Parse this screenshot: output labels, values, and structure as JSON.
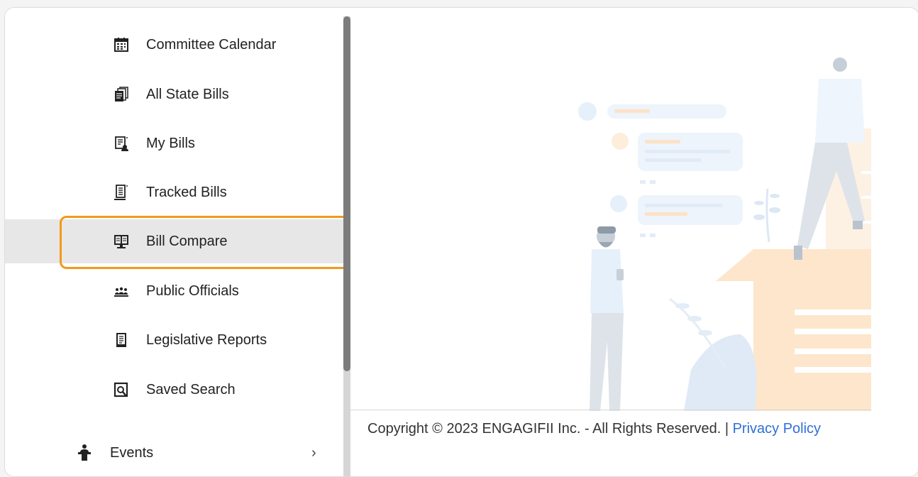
{
  "sidebar": {
    "items": [
      {
        "label": "Committee Calendar",
        "icon": "calendar-icon"
      },
      {
        "label": "All State Bills",
        "icon": "documents-stack-icon"
      },
      {
        "label": "My Bills",
        "icon": "user-document-icon"
      },
      {
        "label": "Tracked Bills",
        "icon": "tracked-document-icon"
      },
      {
        "label": "Bill Compare",
        "icon": "compare-monitor-icon",
        "selected": true
      },
      {
        "label": "Public Officials",
        "icon": "people-group-icon"
      },
      {
        "label": "Legislative Reports",
        "icon": "report-icon"
      },
      {
        "label": "Saved Search",
        "icon": "saved-search-icon"
      }
    ],
    "events": {
      "label": "Events",
      "icon": "speaker-podium-icon",
      "chevron": "›"
    }
  },
  "footer": {
    "copyright": "Copyright © 2023 ENGAGIFII Inc. - All Rights Reserved. | ",
    "privacy_link": "Privacy Policy"
  },
  "colors": {
    "highlight": "#f09a1a",
    "link": "#2f6fd7",
    "selected_bg": "#e7e7e7"
  }
}
